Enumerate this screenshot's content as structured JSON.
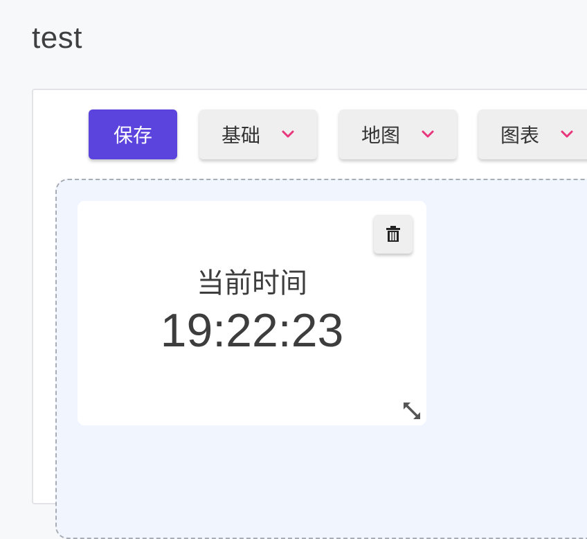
{
  "page": {
    "title": "test"
  },
  "toolbar": {
    "save_label": "保存",
    "menus": [
      {
        "label": "基础",
        "icon": "chevron-down-icon"
      },
      {
        "label": "地图",
        "icon": "chevron-down-icon"
      },
      {
        "label": "图表",
        "icon": "chevron-down-icon"
      }
    ]
  },
  "widget": {
    "label": "当前时间",
    "time": "19:22:23",
    "delete_icon": "trash-icon",
    "resize_icon": "resize-icon"
  },
  "colors": {
    "primary": "#5b43de",
    "chevron": "#e8357b",
    "canvas_bg": "#f1f5fd"
  }
}
